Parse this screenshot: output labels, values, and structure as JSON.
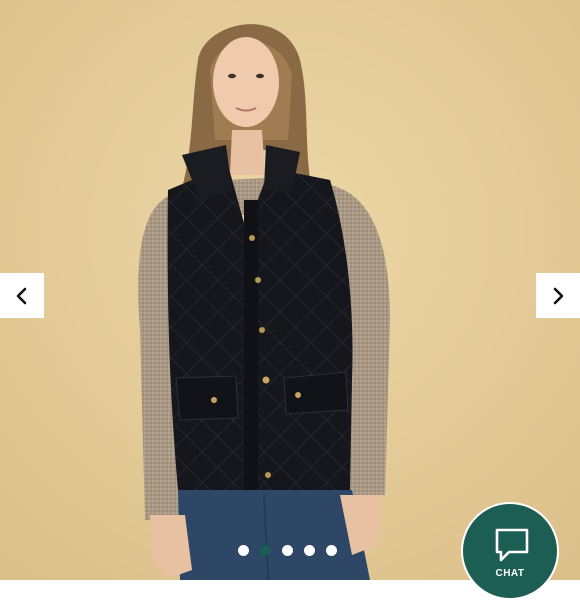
{
  "colors": {
    "backdrop": "#e6cf9c",
    "chat_button": "#1d5e54",
    "active_dot": "#1d5e54",
    "inactive_dot": "#ffffff"
  },
  "icons": {
    "prev": "chevron-left-icon",
    "next": "chevron-right-icon",
    "chat": "speech-bubble-icon"
  },
  "carousel": {
    "slide_count": 5,
    "active_index": 1
  },
  "chat": {
    "label": "CHAT"
  }
}
